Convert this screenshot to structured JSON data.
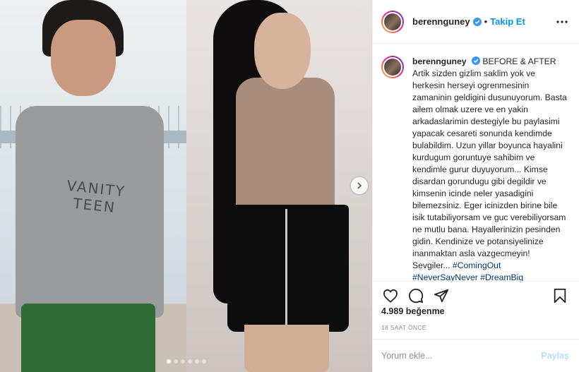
{
  "header": {
    "username": "berennguney",
    "separator": "•",
    "follow_label": "Takip Et",
    "icons": {
      "verified": "verified-badge-icon",
      "more": "more-options-icon"
    }
  },
  "caption": {
    "username": "berennguney",
    "title": "BEFORE & AFTER",
    "body": "Artik sizden gizlim saklim yok ve herkesin herseyi ogrenmesinin zamaninin geldigini dusunuyorum. Basta ailem olmak uzere ve en yakin arkadaslarimin destegiyle bu paylasimi yapacak cesareti sonunda kendimde bulabildim. Uzun yillar boyunca hayalini kurdugum goruntuye sahibim ve kendimle gurur duyuyorum... Kimse disardan gorundugu gibi degildir ve kimsenin icinde neler yasadigini bilemezsiniz. Eger icinizden birine bile isik tutabiliyorsam ve guc verebiliyorsam ne mutlu bana. Hayallerinizin pesinden gidin. Kendinize ve potansiyelinize inanmaktan asla vazgecmeyin! Sevgiler...",
    "hashtags": [
      "#ComingOut",
      "#NeverSayNever",
      "#DreamBig"
    ]
  },
  "media": {
    "shirt_text": "VANITY TEEN",
    "carousel_dots": 6,
    "active_dot": 0,
    "icons": {
      "next": "chevron-right-icon"
    }
  },
  "actions": {
    "icons": [
      "heart-icon",
      "comment-icon",
      "share-icon",
      "bookmark-icon"
    ]
  },
  "likes": "4.989 beğenme",
  "timestamp": "18 SAAT ÖNCE",
  "comment": {
    "placeholder": "Yorum ekle...",
    "post_label": "Paylaş"
  },
  "colors": {
    "accent": "#0095f6",
    "post_disabled": "#b2dffc",
    "hashtag": "#00376b",
    "muted": "#8e8e8e"
  }
}
